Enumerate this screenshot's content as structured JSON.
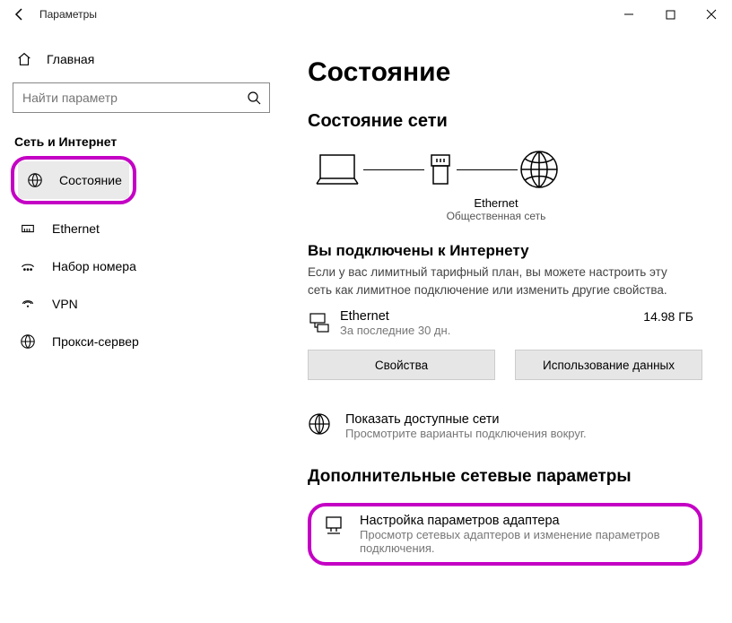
{
  "window": {
    "title": "Параметры"
  },
  "sidebar": {
    "home": "Главная",
    "search_placeholder": "Найти параметр",
    "category": "Сеть и Интернет",
    "items": [
      {
        "label": "Состояние"
      },
      {
        "label": "Ethernet"
      },
      {
        "label": "Набор номера"
      },
      {
        "label": "VPN"
      },
      {
        "label": "Прокси-сервер"
      }
    ]
  },
  "main": {
    "page_title": "Состояние",
    "network_status_heading": "Состояние сети",
    "diagram": {
      "center_label": "Ethernet",
      "center_sub": "Общественная сеть"
    },
    "connected": {
      "title": "Вы подключены к Интернету",
      "desc": "Если у вас лимитный тарифный план, вы можете настроить эту сеть как лимитное подключение или изменить другие свойства."
    },
    "usage": {
      "name": "Ethernet",
      "period": "За последние 30 дн.",
      "value": "14.98 ГБ"
    },
    "buttons": {
      "properties": "Свойства",
      "data_usage": "Использование данных"
    },
    "available": {
      "title": "Показать доступные сети",
      "sub": "Просмотрите варианты подключения вокруг."
    },
    "advanced_heading": "Дополнительные сетевые параметры",
    "adapter": {
      "title": "Настройка параметров адаптера",
      "sub": "Просмотр сетевых адаптеров и изменение параметров подключения."
    }
  }
}
